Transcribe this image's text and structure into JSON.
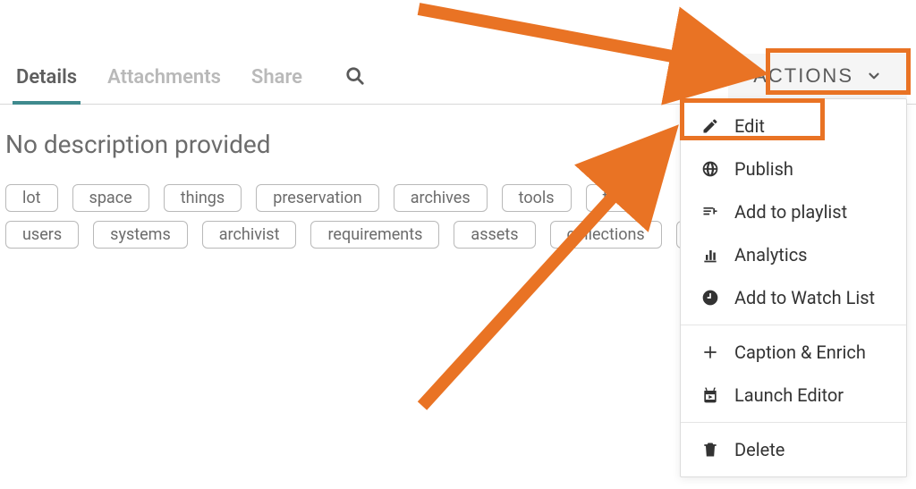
{
  "tabs": {
    "details": "Details",
    "attachments": "Attachments",
    "share": "Share"
  },
  "description": "No description provided",
  "tags": {
    "row1": {
      "lot": "lot",
      "space": "space",
      "things": "things",
      "preservation": "preservation",
      "archives": "archives",
      "tools": "tools",
      "partial": "th"
    },
    "row2": {
      "users": "users",
      "systems": "systems",
      "archivist": "archivist",
      "requirements": "requirements",
      "assets": "assets",
      "collections": "collections"
    }
  },
  "actions": {
    "button": "ACTIONS",
    "menu": {
      "edit": "Edit",
      "publish": "Publish",
      "add_to_playlist": "Add to playlist",
      "analytics": "Analytics",
      "add_to_watch_list": "Add to Watch List",
      "caption_enrich": "Caption & Enrich",
      "launch_editor": "Launch Editor",
      "delete": "Delete"
    }
  }
}
